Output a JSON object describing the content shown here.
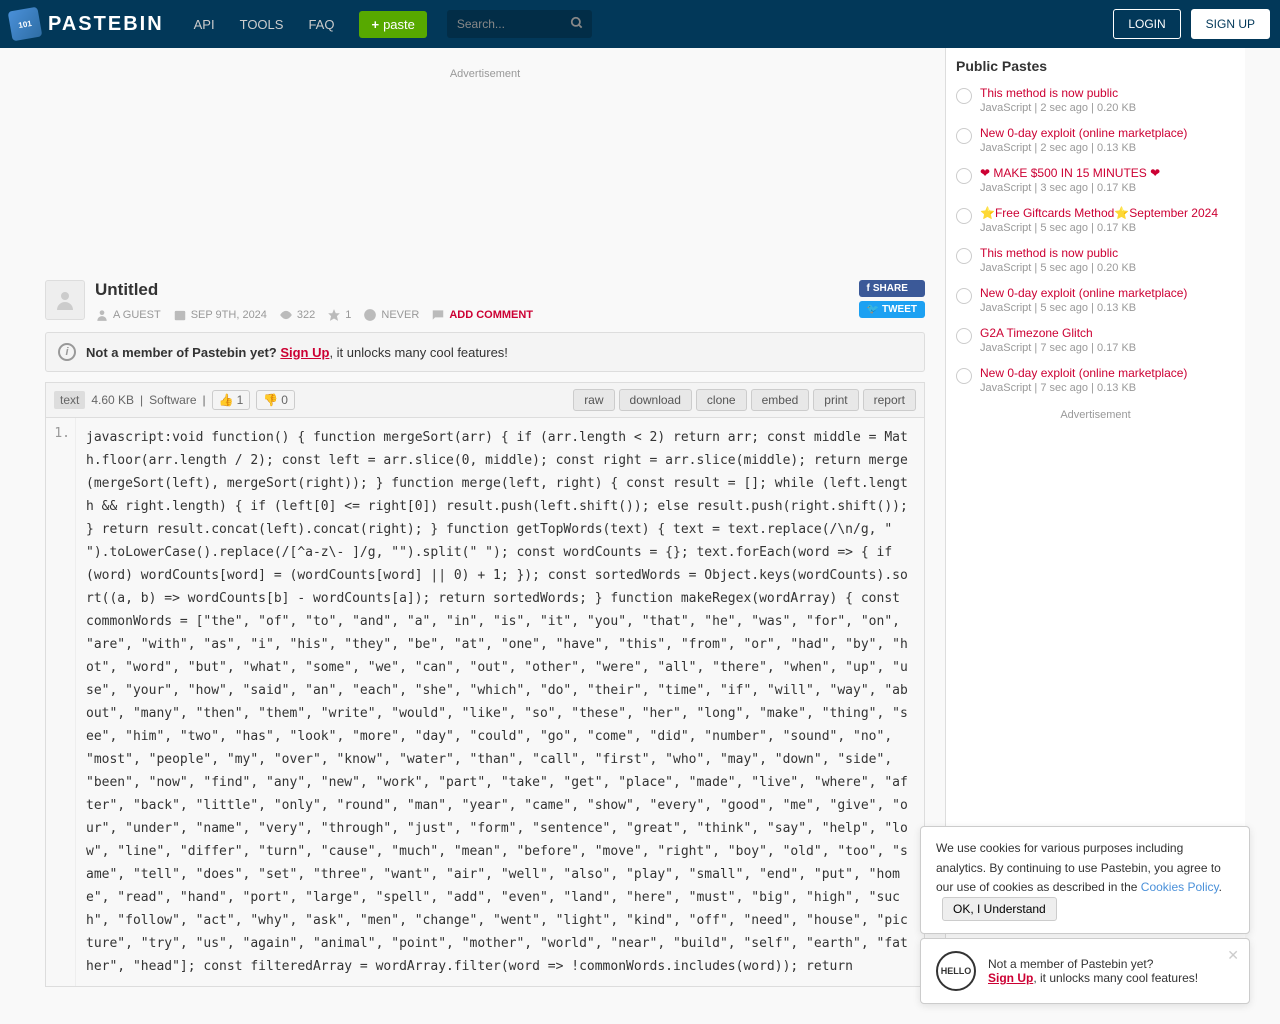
{
  "header": {
    "brand": "PASTEBIN",
    "nav": [
      "API",
      "TOOLS",
      "FAQ"
    ],
    "paste_btn": "paste",
    "search_placeholder": "Search...",
    "login": "LOGIN",
    "signup": "SIGN UP"
  },
  "ad_label": "Advertisement",
  "paste": {
    "title": "Untitled",
    "author": "A GUEST",
    "date": "SEP 9TH, 2024",
    "views": "322",
    "rating": "1",
    "expires": "NEVER",
    "add_comment": "ADD COMMENT",
    "share": "SHARE",
    "tweet": "TWEET"
  },
  "notice": {
    "prefix": "Not a member of Pastebin yet? ",
    "link": "Sign Up",
    "suffix": ", it unlocks many cool features!"
  },
  "toolbar": {
    "lang": "text",
    "size": "4.60 KB",
    "category": "Software",
    "up": "1",
    "down": "0",
    "buttons": [
      "raw",
      "download",
      "clone",
      "embed",
      "print",
      "report"
    ]
  },
  "code": {
    "line_num": "1.",
    "content": "javascript:void function() { function mergeSort(arr) { if (arr.length < 2) return arr; const middle = Math.floor(arr.length / 2); const left = arr.slice(0, middle); const right = arr.slice(middle); return merge(mergeSort(left), mergeSort(right)); } function merge(left, right) { const result = []; while (left.length && right.length) { if (left[0] <= right[0]) result.push(left.shift()); else result.push(right.shift()); } return result.concat(left).concat(right); } function getTopWords(text) { text = text.replace(/\\n/g, \" \").toLowerCase().replace(/[^a-z\\- ]/g, \"\").split(\" \"); const wordCounts = {}; text.forEach(word => { if (word) wordCounts[word] = (wordCounts[word] || 0) + 1; }); const sortedWords = Object.keys(wordCounts).sort((a, b) => wordCounts[b] - wordCounts[a]); return sortedWords; } function makeRegex(wordArray) { const commonWords = [\"the\", \"of\", \"to\", \"and\", \"a\", \"in\", \"is\", \"it\", \"you\", \"that\", \"he\", \"was\", \"for\", \"on\", \"are\", \"with\", \"as\", \"i\", \"his\", \"they\", \"be\", \"at\", \"one\", \"have\", \"this\", \"from\", \"or\", \"had\", \"by\", \"hot\", \"word\", \"but\", \"what\", \"some\", \"we\", \"can\", \"out\", \"other\", \"were\", \"all\", \"there\", \"when\", \"up\", \"use\", \"your\", \"how\", \"said\", \"an\", \"each\", \"she\", \"which\", \"do\", \"their\", \"time\", \"if\", \"will\", \"way\", \"about\", \"many\", \"then\", \"them\", \"write\", \"would\", \"like\", \"so\", \"these\", \"her\", \"long\", \"make\", \"thing\", \"see\", \"him\", \"two\", \"has\", \"look\", \"more\", \"day\", \"could\", \"go\", \"come\", \"did\", \"number\", \"sound\", \"no\", \"most\", \"people\", \"my\", \"over\", \"know\", \"water\", \"than\", \"call\", \"first\", \"who\", \"may\", \"down\", \"side\", \"been\", \"now\", \"find\", \"any\", \"new\", \"work\", \"part\", \"take\", \"get\", \"place\", \"made\", \"live\", \"where\", \"after\", \"back\", \"little\", \"only\", \"round\", \"man\", \"year\", \"came\", \"show\", \"every\", \"good\", \"me\", \"give\", \"our\", \"under\", \"name\", \"very\", \"through\", \"just\", \"form\", \"sentence\", \"great\", \"think\", \"say\", \"help\", \"low\", \"line\", \"differ\", \"turn\", \"cause\", \"much\", \"mean\", \"before\", \"move\", \"right\", \"boy\", \"old\", \"too\", \"same\", \"tell\", \"does\", \"set\", \"three\", \"want\", \"air\", \"well\", \"also\", \"play\", \"small\", \"end\", \"put\", \"home\", \"read\", \"hand\", \"port\", \"large\", \"spell\", \"add\", \"even\", \"land\", \"here\", \"must\", \"big\", \"high\", \"such\", \"follow\", \"act\", \"why\", \"ask\", \"men\", \"change\", \"went\", \"light\", \"kind\", \"off\", \"need\", \"house\", \"picture\", \"try\", \"us\", \"again\", \"animal\", \"point\", \"mother\", \"world\", \"near\", \"build\", \"self\", \"earth\", \"father\", \"head\"]; const filteredArray = wordArray.filter(word => !commonWords.includes(word)); return"
  },
  "sidebar": {
    "title": "Public Pastes",
    "items": [
      {
        "title": "This method is now public",
        "meta": "JavaScript | 2 sec ago | 0.20 KB"
      },
      {
        "title": "New 0-day exploit (online marketplace)",
        "meta": "JavaScript | 2 sec ago | 0.13 KB"
      },
      {
        "title": "❤ MAKE $500 IN 15 MINUTES ❤",
        "meta": "JavaScript | 3 sec ago | 0.17 KB"
      },
      {
        "title": "⭐Free Giftcards Method⭐September 2024",
        "meta": "JavaScript | 5 sec ago | 0.17 KB"
      },
      {
        "title": "This method is now public",
        "meta": "JavaScript | 5 sec ago | 0.20 KB"
      },
      {
        "title": "New 0-day exploit (online marketplace)",
        "meta": "JavaScript | 5 sec ago | 0.13 KB"
      },
      {
        "title": "G2A Timezone Glitch",
        "meta": "JavaScript | 7 sec ago | 0.17 KB"
      },
      {
        "title": "New 0-day exploit (online marketplace)",
        "meta": "JavaScript | 7 sec ago | 0.13 KB"
      }
    ],
    "ad": "Advertisement"
  },
  "cookie": {
    "text": "We use cookies for various purposes including analytics. By continuing to use Pastebin, you agree to our use of cookies as described in the ",
    "link": "Cookies Policy",
    "ok": "OK, I Understand"
  },
  "member": {
    "hello": "HELLO",
    "line1": "Not a member of Pastebin yet?",
    "link": "Sign Up",
    "suffix": ", it unlocks many cool features!"
  }
}
